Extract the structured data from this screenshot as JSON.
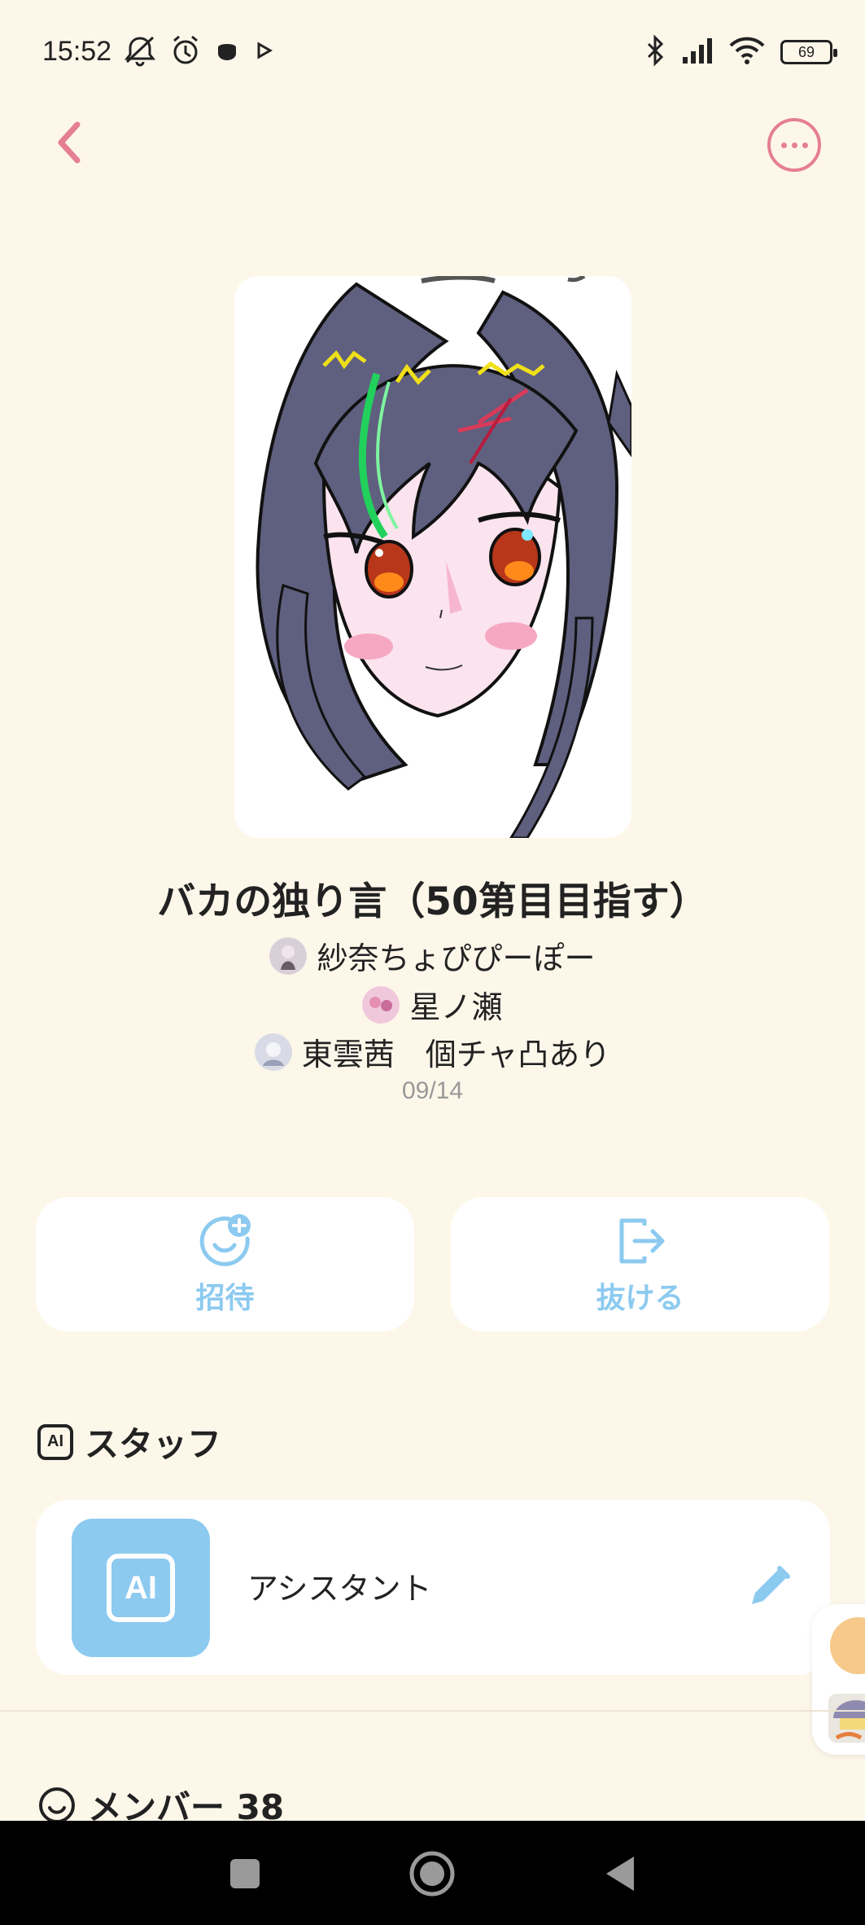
{
  "status_bar": {
    "time": "15:52",
    "battery": "69",
    "left_icons": [
      "mute-icon",
      "alarm-icon",
      "cup-icon",
      "play-store-icon"
    ],
    "right_icons": [
      "bluetooth-icon",
      "signal-icon",
      "wifi-icon",
      "battery-icon"
    ]
  },
  "header": {
    "back_icon": "chevron-left-icon",
    "more_icon": "more-horizontal-icon",
    "accent_color": "#e57f93"
  },
  "room": {
    "title": "バカの独り言（50第目目指す）",
    "hosts": [
      {
        "name": "紗奈ちょぴぴーぽー",
        "avatar_color": "#d9cfd6"
      },
      {
        "name": "星ノ瀬",
        "avatar_color": "#f0c8dc"
      },
      {
        "name": "東雲茜　個チャ凸あり",
        "avatar_color": "#d8dbe6"
      }
    ],
    "date": "09/14"
  },
  "actions": {
    "invite_label": "招待",
    "leave_label": "抜ける",
    "color": "#8ccaf0"
  },
  "staff": {
    "section_title": "スタッフ",
    "section_icon_text": "AI",
    "assistant_icon_text": "AI",
    "assistant_name": "アシスタント"
  },
  "members": {
    "section_title": "メンバー 38"
  },
  "nav": {
    "icons": [
      "recents-square-icon",
      "home-circle-icon",
      "back-triangle-icon"
    ]
  }
}
